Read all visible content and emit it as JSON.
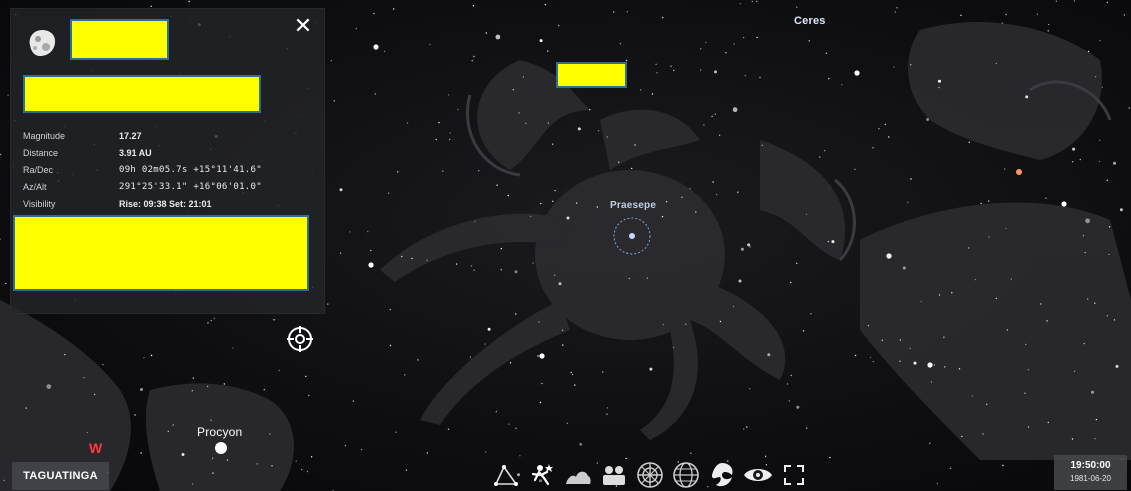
{
  "sky": {
    "labels": {
      "ceres": "Ceres",
      "praesepe": "Praesepe",
      "procyon": "Procyon",
      "west_marker": "W"
    }
  },
  "info_panel": {
    "close_symbol": "✕",
    "rows": [
      {
        "key": "Magnitude",
        "value": "17.27"
      },
      {
        "key": "Distance",
        "value": "3.91 AU"
      },
      {
        "key": "Ra/Dec",
        "value": "09h 02m05.7s  +15°11'41.6\""
      },
      {
        "key": "Az/Alt",
        "value": "291°25'33.1\"  +16°06'01.0\""
      },
      {
        "key": "Visibility",
        "value": "Rise: 09:38   Set: 21:01"
      }
    ]
  },
  "location": {
    "name": "TAGUATINGA"
  },
  "toolbar": {
    "buttons": [
      {
        "name": "constellation-lines-icon"
      },
      {
        "name": "constellation-art-icon"
      },
      {
        "name": "landscape-icon"
      },
      {
        "name": "atmosphere-icon"
      },
      {
        "name": "azimuthal-grid-icon"
      },
      {
        "name": "equatorial-grid-icon"
      },
      {
        "name": "deep-sky-objects-icon"
      },
      {
        "name": "night-mode-eye-icon"
      },
      {
        "name": "fullscreen-icon"
      }
    ]
  },
  "time": {
    "clock": "19:50:00",
    "date": "1981-06-20"
  }
}
